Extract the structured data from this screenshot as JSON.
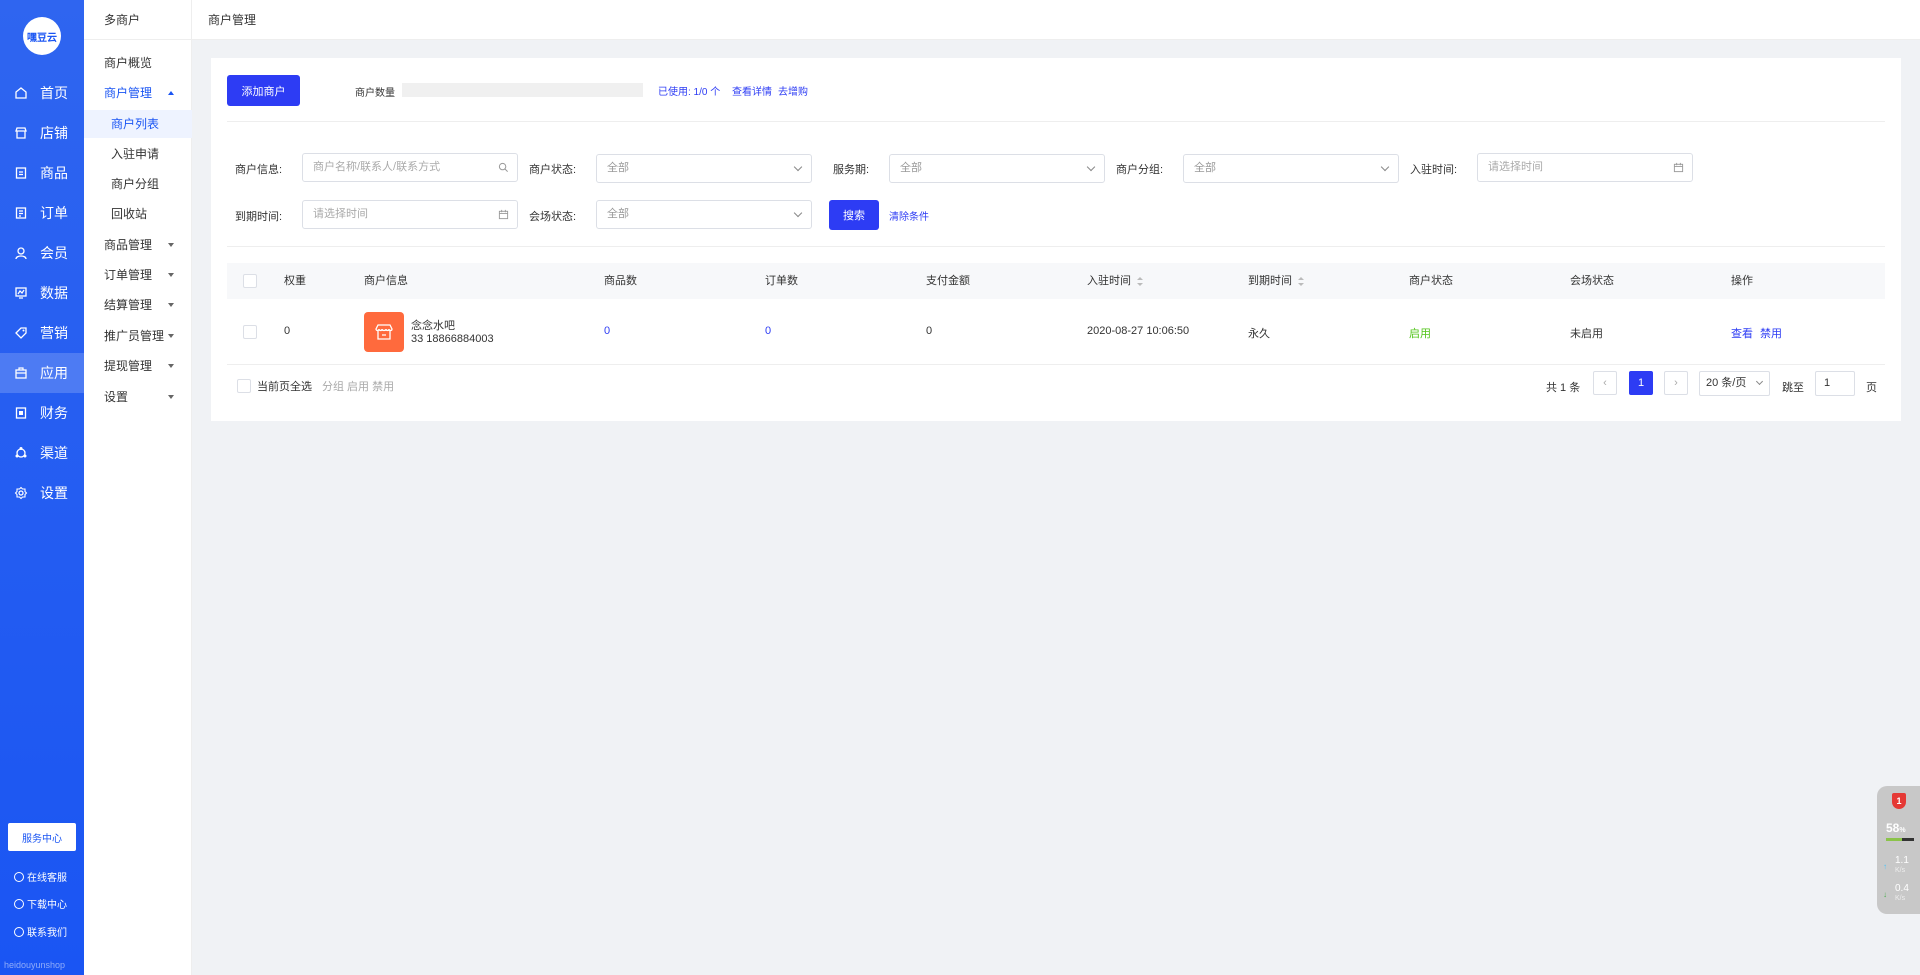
{
  "logo": {
    "text": "嘿豆云"
  },
  "nav": [
    {
      "label": "首页",
      "icon": "home-icon"
    },
    {
      "label": "店铺",
      "icon": "store-icon"
    },
    {
      "label": "商品",
      "icon": "goods-icon"
    },
    {
      "label": "订单",
      "icon": "order-icon"
    },
    {
      "label": "会员",
      "icon": "member-icon"
    },
    {
      "label": "数据",
      "icon": "data-icon"
    },
    {
      "label": "营销",
      "icon": "tag-icon"
    },
    {
      "label": "应用",
      "icon": "app-icon",
      "active": true
    },
    {
      "label": "财务",
      "icon": "finance-icon"
    },
    {
      "label": "渠道",
      "icon": "channel-icon"
    },
    {
      "label": "设置",
      "icon": "gear-icon"
    }
  ],
  "sidebar_footer": {
    "service_center": "服务中心",
    "links": [
      "在线客服",
      "下载中心",
      "联系我们"
    ],
    "watermark": "heidouyunshop"
  },
  "sub_sidebar": {
    "title": "多商户",
    "items": {
      "overview": "商户概览",
      "merchant_mgmt": "商户管理",
      "merchant_list": "商户列表",
      "apply": "入驻申请",
      "group": "商户分组",
      "recycle": "回收站",
      "goods_mgmt": "商品管理",
      "order_mgmt": "订单管理",
      "settle_mgmt": "结算管理",
      "promoter_mgmt": "推广员管理",
      "withdraw_mgmt": "提现管理",
      "settings": "设置"
    }
  },
  "topbar": {
    "title": "商户管理"
  },
  "header": {
    "add_button": "添加商户",
    "count_label": "商户数量",
    "usage_fraction": 0,
    "usage_text": "已使用: 1/0 个",
    "view_detail": "查看详情",
    "expand": "去增购"
  },
  "filters": {
    "merchant_info_label": "商户信息:",
    "merchant_info_placeholder": "商户名称/联系人/联系方式",
    "merchant_status_label": "商户状态:",
    "merchant_status_value": "全部",
    "service_period_label": "服务期:",
    "service_period_value": "全部",
    "merchant_group_label": "商户分组:",
    "merchant_group_value": "全部",
    "join_time_label": "入驻时间:",
    "join_time_placeholder": "请选择时间",
    "expire_time_label": "到期时间:",
    "expire_time_placeholder": "请选择时间",
    "venue_status_label": "会场状态:",
    "venue_status_value": "全部",
    "search_button": "搜索",
    "clear_link": "清除条件"
  },
  "table": {
    "columns": {
      "weight": "权重",
      "info": "商户信息",
      "goods": "商品数",
      "orders": "订单数",
      "paid": "支付金额",
      "join_time": "入驻时间",
      "expire_time": "到期时间",
      "status": "商户状态",
      "venue": "会场状态",
      "action": "操作"
    },
    "rows": [
      {
        "weight": "0",
        "name": "念念水吧",
        "contact": "33 18866884003",
        "goods": "0",
        "orders": "0",
        "paid": "0",
        "join_time": "2020-08-27 10:06:50",
        "expire_time": "永久",
        "status": "启用",
        "venue": "未启用",
        "action_view": "查看",
        "action_disable": "禁用"
      }
    ]
  },
  "table_footer": {
    "select_all": "当前页全选",
    "batch_actions": "分组 启用 禁用",
    "total": "共 1 条",
    "current_page": "1",
    "page_size": "20 条/页",
    "jump_label": "跳至",
    "jump_value": "1",
    "page_unit": "页"
  },
  "speed_widget": {
    "badge": "1",
    "percent": "58",
    "percent_unit": "%",
    "up_value": "1.1",
    "up_unit": "K/s",
    "down_value": "0.4",
    "down_unit": "K/s"
  }
}
